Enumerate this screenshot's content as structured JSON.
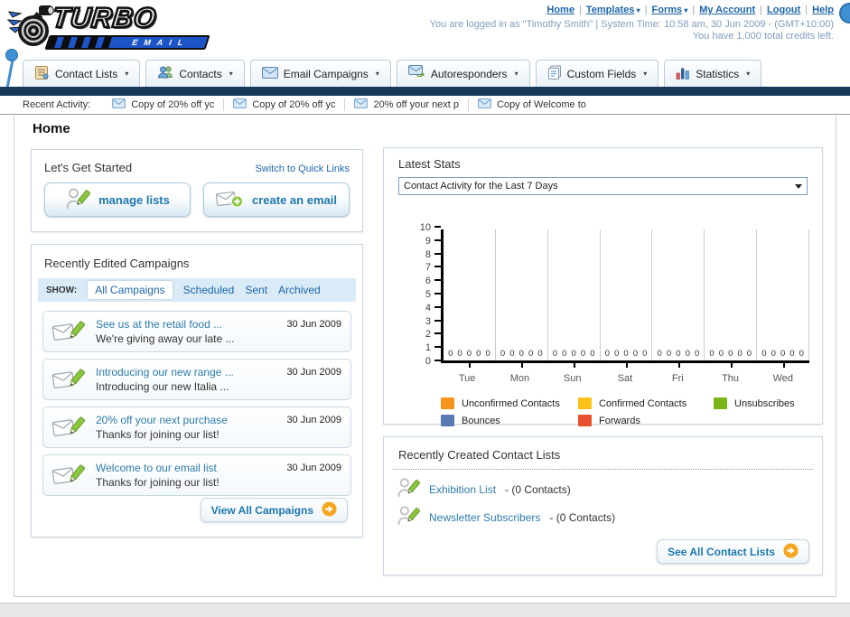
{
  "brand": {
    "name_top": "TURBO",
    "name_bottom": "EMAIL"
  },
  "header": {
    "links": [
      {
        "label": "Home",
        "dropdown": false
      },
      {
        "label": "Templates",
        "dropdown": true
      },
      {
        "label": "Forms",
        "dropdown": true
      },
      {
        "label": "My Account",
        "dropdown": false
      },
      {
        "label": "Logout",
        "dropdown": false
      },
      {
        "label": "Help",
        "dropdown": false
      }
    ],
    "login_line": "You are logged in as \"Timothy Smith\" | System Time: 10:58 am, 30 Jun 2009 - (GMT+10:00)",
    "credits_line": "You have 1,000 total credits left."
  },
  "nav_tabs": [
    {
      "label": "Contact Lists",
      "icon": "contact-lists-icon"
    },
    {
      "label": "Contacts",
      "icon": "contacts-icon"
    },
    {
      "label": "Email Campaigns",
      "icon": "email-campaigns-icon"
    },
    {
      "label": "Autoresponders",
      "icon": "autoresponders-icon"
    },
    {
      "label": "Custom Fields",
      "icon": "custom-fields-icon"
    },
    {
      "label": "Statistics",
      "icon": "statistics-icon"
    }
  ],
  "recent_activity": {
    "label": "Recent Activity:",
    "items": [
      "Copy of 20% off yc",
      "Copy of 20% off yc",
      "20% off your next p",
      "Copy of Welcome to"
    ]
  },
  "page_title": "Home",
  "get_started": {
    "title": "Let's Get Started",
    "switch_link": "Switch to Quick Links",
    "manage_lists_label": "manage lists",
    "create_email_label": "create an email"
  },
  "campaigns": {
    "title": "Recently Edited Campaigns",
    "show_label": "SHOW:",
    "filters": [
      {
        "label": "All Campaigns",
        "active": true
      },
      {
        "label": "Scheduled",
        "active": false
      },
      {
        "label": "Sent",
        "active": false
      },
      {
        "label": "Archived",
        "active": false
      }
    ],
    "items": [
      {
        "title": "See us at the retail food ...",
        "subtitle": "We're giving away our late ...",
        "date": "30 Jun 2009"
      },
      {
        "title": "Introducing our new range ...",
        "subtitle": "Introducing our new Italia ...",
        "date": "30 Jun 2009"
      },
      {
        "title": "20% off your next purchase",
        "subtitle": "Thanks for joining our list!",
        "date": "30 Jun 2009"
      },
      {
        "title": "Welcome to our email list",
        "subtitle": "Thanks for joining our list!",
        "date": "30 Jun 2009"
      }
    ],
    "view_all_label": "View All Campaigns"
  },
  "stats": {
    "title": "Latest Stats",
    "dropdown_value": "Contact Activity for the Last 7 Days"
  },
  "chart_data": {
    "type": "bar",
    "title": "Contact Activity for the Last 7 Days",
    "categories": [
      "Tue",
      "Mon",
      "Sun",
      "Sat",
      "Fri",
      "Thu",
      "Wed"
    ],
    "series": [
      {
        "name": "Unconfirmed Contacts",
        "color": "#F6921E",
        "values": [
          0,
          0,
          0,
          0,
          0,
          0,
          0
        ]
      },
      {
        "name": "Confirmed Contacts",
        "color": "#FCC21B",
        "values": [
          0,
          0,
          0,
          0,
          0,
          0,
          0
        ]
      },
      {
        "name": "Unsubscribes",
        "color": "#7CB319",
        "values": [
          0,
          0,
          0,
          0,
          0,
          0,
          0
        ]
      },
      {
        "name": "Bounces",
        "color": "#5B79B5",
        "values": [
          0,
          0,
          0,
          0,
          0,
          0,
          0
        ]
      },
      {
        "name": "Forwards",
        "color": "#E8512D",
        "values": [
          0,
          0,
          0,
          0,
          0,
          0,
          0
        ]
      }
    ],
    "ylim": [
      0,
      10
    ],
    "y_ticks": [
      0,
      1,
      2,
      3,
      4,
      5,
      6,
      7,
      8,
      9,
      10
    ],
    "grid": true,
    "legend_position": "bottom",
    "value_labels_shown": true
  },
  "contact_lists": {
    "title": "Recently Created Contact Lists",
    "items": [
      {
        "name": "Exhibition List",
        "detail": "- (0 Contacts)"
      },
      {
        "name": "Newsletter Subscribers",
        "detail": "- (0 Contacts)"
      }
    ],
    "see_all_label": "See All Contact Lists"
  },
  "colors": {
    "link_blue": "#1F66A8",
    "content_link": "#2E7CA8",
    "navy_bar": "#16395C",
    "button_text": "#1F77AE",
    "arrow_circle": "#F6A51F",
    "filter_bar_bg": "#D9EBF7"
  }
}
